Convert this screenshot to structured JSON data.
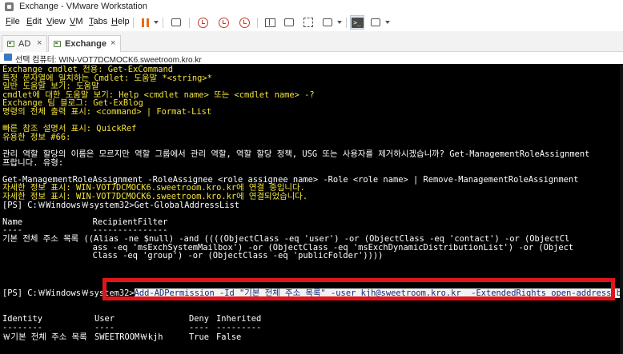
{
  "window": {
    "title": "Exchange - VMware Workstation"
  },
  "menu": {
    "items": [
      {
        "label": "File",
        "key": "F",
        "rest": "ile"
      },
      {
        "label": "Edit",
        "key": "E",
        "rest": "dit"
      },
      {
        "label": "View",
        "key": "V",
        "rest": "iew"
      },
      {
        "label": "VM",
        "key": "V",
        "rest": "M"
      },
      {
        "label": "Tabs",
        "key": "T",
        "rest": "abs"
      },
      {
        "label": "Help",
        "key": "H",
        "rest": "elp"
      }
    ]
  },
  "toolbar": {
    "icons": [
      "pause-icon",
      "send-ctrl-alt-del-icon",
      "snapshot-icon",
      "revert-snapshot-icon",
      "manage-snapshots-icon",
      "unity-icon",
      "console-view-icon",
      "fullscreen-icon",
      "stretch-icon",
      "console-icon"
    ],
    "accent": "#e86b14"
  },
  "tabs": [
    {
      "label": "AD",
      "active": false
    },
    {
      "label": "Exchange",
      "active": true
    }
  ],
  "connection": {
    "label": "선택 컴퓨터: WIN-VOT7DCMOCK6.sweetroom.kro.kr"
  },
  "console": {
    "lines": [
      {
        "text": "Exchange cmdlet 전용: Get-ExCommand",
        "color": "yellow"
      },
      {
        "text": "특정 문자열에 일치하는 Cmdlet: 도움말 *<string>*",
        "color": "yellow"
      },
      {
        "text": "일반 도움말 보기: 도움말",
        "color": "yellow"
      },
      {
        "text": "cmdlet에 대한 도움말 보기: Help <cmdlet name> 또는 <cmdlet name> -?",
        "color": "yellow"
      },
      {
        "text": "Exchange 팀 블로그: Get-ExBlog",
        "color": "yellow"
      },
      {
        "text": "명령의 전체 출력 표시: <command> | Format-List",
        "color": "yellow"
      },
      {
        "text": "",
        "color": "white"
      },
      {
        "text": "빠른 참조 설명서 표시: QuickRef",
        "color": "yellow"
      },
      {
        "text": "유용한 정보 #66:",
        "color": "yellow"
      },
      {
        "text": "",
        "color": "white"
      },
      {
        "text": "관리 역할 할당의 이름은 모르지만 역할 그룹에서 관리 역할, 역할 할당 정책, USG 또는 사용자를 제거하시겠습니까? Get-ManagementRoleAssignment",
        "color": "white"
      },
      {
        "text": "프랍니다. 유형:",
        "color": "white"
      },
      {
        "text": "",
        "color": "white"
      },
      {
        "text": "Get-ManagementRoleAssignment -RoleAssignee <role assignee name> -Role <role name> | Remove-ManagementRoleAssignment",
        "color": "white"
      },
      {
        "text": "자세한 정보 표시: WIN-VOT7DCMOCK6.sweetroom.kro.kr에 연결 중입니다.",
        "color": "yellow"
      },
      {
        "text": "자세한 정보 표시: WIN-VOT7DCMOCK6.sweetroom.kro.kr에 연결되었습니다.",
        "color": "yellow"
      },
      {
        "text": "[PS] C:￦Windows￦system32>Get-GlobalAddressList",
        "color": "white"
      },
      {
        "text": "",
        "color": "white"
      },
      {
        "text": "Name              RecipientFilter",
        "color": "white"
      },
      {
        "text": "----              ---------------",
        "color": "white"
      },
      {
        "text": "기본 전체 주소 목록 ((Alias -ne $null) -and ((((ObjectClass -eq 'user') -or (ObjectClass -eq 'contact') -or (ObjectCl",
        "color": "white"
      },
      {
        "text": "                  ass -eq 'msExchSystemMailbox') -or (ObjectClass -eq 'msExchDynamicDistributionList') -or (Object",
        "color": "white"
      },
      {
        "text": "                  Class -eq 'group') -or (ObjectClass -eq 'publicFolder'))))",
        "color": "white"
      }
    ],
    "command": {
      "prompt": "[PS] C:￦Windows￦system32>",
      "text": "Add-ADPermission -Id \"기본 전체 주소 목록\" -user kjh@sweetroom.kro.kr  -ExtendedRights open-address-book -deny"
    },
    "result": {
      "headers": [
        "Identity",
        "User",
        "Deny",
        "Inherited"
      ],
      "underlines": [
        "--------",
        "----",
        "----",
        "---------"
      ],
      "row": [
        "￦기본 전체 주소 목록",
        "SWEETROOM￦kjh",
        "True",
        "False"
      ]
    },
    "highlight_color": "#e0151b"
  }
}
